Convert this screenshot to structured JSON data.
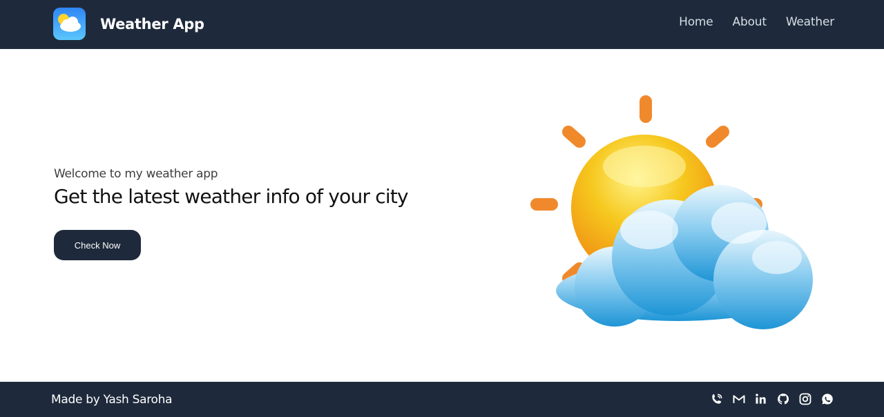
{
  "header": {
    "brand_title": "Weather App",
    "nav": [
      {
        "label": "Home"
      },
      {
        "label": "About"
      },
      {
        "label": "Weather"
      }
    ]
  },
  "hero": {
    "subtitle": "Welcome to my weather app",
    "title": "Get the latest weather info of your city",
    "cta_label": "Check Now"
  },
  "footer": {
    "credit": "Made by Yash Saroha",
    "social_icons": [
      "phone-icon",
      "gmail-icon",
      "linkedin-icon",
      "github-icon",
      "instagram-icon",
      "whatsapp-icon"
    ]
  },
  "colors": {
    "navbar_bg": "#1e2a3b",
    "button_bg": "#1e2a3b",
    "sun_orange": "#f0892b",
    "sun_yellow": "#f6c81e",
    "cloud_blue": "#3ba7e0"
  }
}
